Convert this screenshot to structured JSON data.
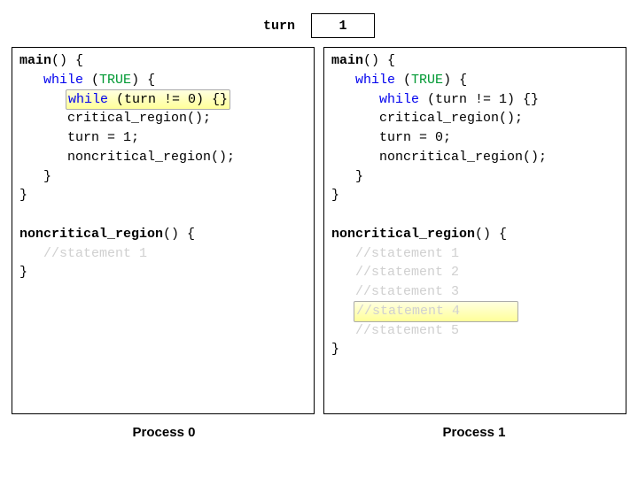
{
  "header": {
    "turn_label": "turn",
    "turn_value": "1"
  },
  "left": {
    "l1a": "main",
    "l1b": "() {",
    "l2a": "   ",
    "l2b": "while",
    "l2c": " (",
    "l2d": "TRUE",
    "l2e": ") {",
    "l3pad": "      ",
    "l3a": "while",
    "l3b": " (turn != 0) {}",
    "l4": "      critical_region();",
    "l5": "      turn = 1;",
    "l6": "      noncritical_region();",
    "l7": "   }",
    "l8": "}",
    "n1a": "noncritical_region",
    "n1b": "() {",
    "n2": "   //statement 1",
    "n3": "}"
  },
  "right": {
    "l1a": "main",
    "l1b": "() {",
    "l2a": "   ",
    "l2b": "while",
    "l2c": " (",
    "l2d": "TRUE",
    "l2e": ") {",
    "l3a": "      ",
    "l3b": "while",
    "l3c": " (turn != 1) {}",
    "l4": "      critical_region();",
    "l5": "      turn = 0;",
    "l6": "      noncritical_region();",
    "l7": "   }",
    "l8": "}",
    "n1a": "noncritical_region",
    "n1b": "() {",
    "n2": "   //statement 1",
    "n3": "   //statement 2",
    "n4": "   //statement 3",
    "n5pad": "   ",
    "n5": "//statement 4",
    "n5trail": "       ",
    "n6": "   //statement 5",
    "n7": "}"
  },
  "footer": {
    "left": "Process 0",
    "right": "Process 1"
  }
}
